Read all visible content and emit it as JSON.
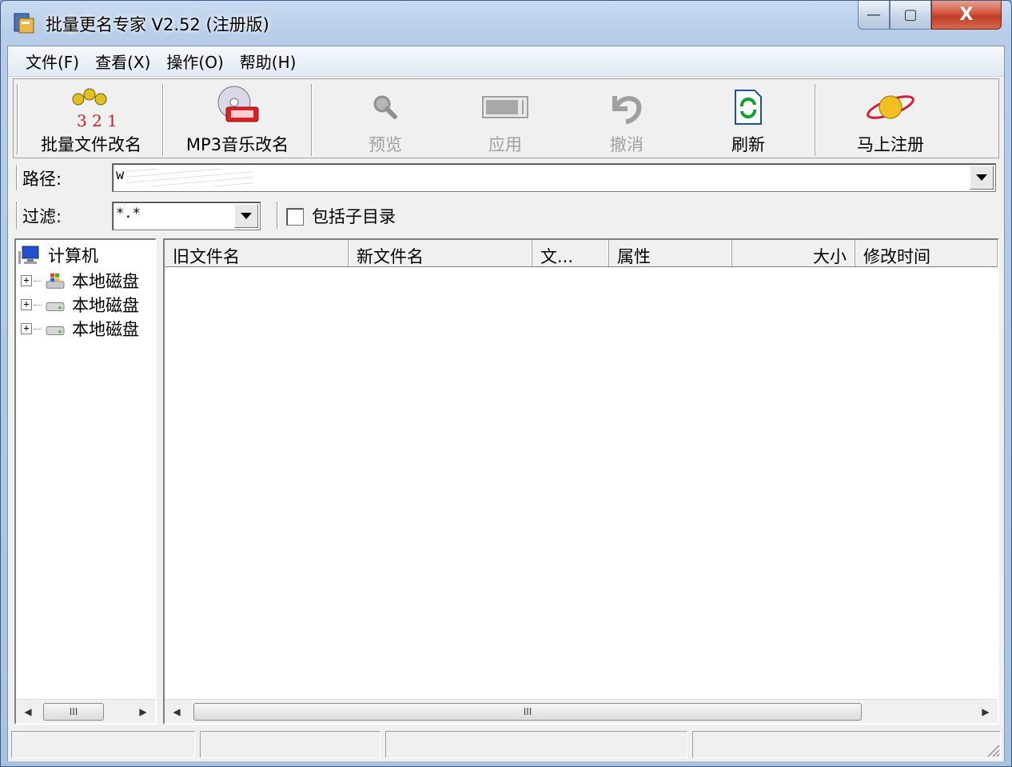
{
  "window": {
    "title": "批量更名专家 V2.52 (注册版)",
    "controls": {
      "minimize": "—",
      "maximize": "▢",
      "close": "X"
    }
  },
  "menu": [
    "文件(F)",
    "查看(X)",
    "操作(O)",
    "帮助(H)"
  ],
  "toolbar": {
    "batch_rename": "批量文件改名",
    "mp3_rename": "MP3音乐改名",
    "preview": "预览",
    "apply": "应用",
    "undo": "撤消",
    "refresh": "刷新",
    "register": "马上注册",
    "batch_icon_digits": "3 2 1"
  },
  "path": {
    "label": "路径:",
    "value": "w"
  },
  "filter": {
    "label": "过滤:",
    "value": "*.*",
    "include_subdirs_label": "包括子目录",
    "include_subdirs_checked": false
  },
  "tree": {
    "root": "计算机",
    "drives": [
      "本地磁盘",
      "本地磁盘",
      "本地磁盘"
    ]
  },
  "list": {
    "columns": [
      "旧文件名",
      "新文件名",
      "文...",
      "属性",
      "大小",
      "修改时间"
    ],
    "rows": []
  },
  "scroll_thumb": "III",
  "colors": {
    "accent": "#c03c26",
    "title_bg": "#c9dcf1"
  }
}
